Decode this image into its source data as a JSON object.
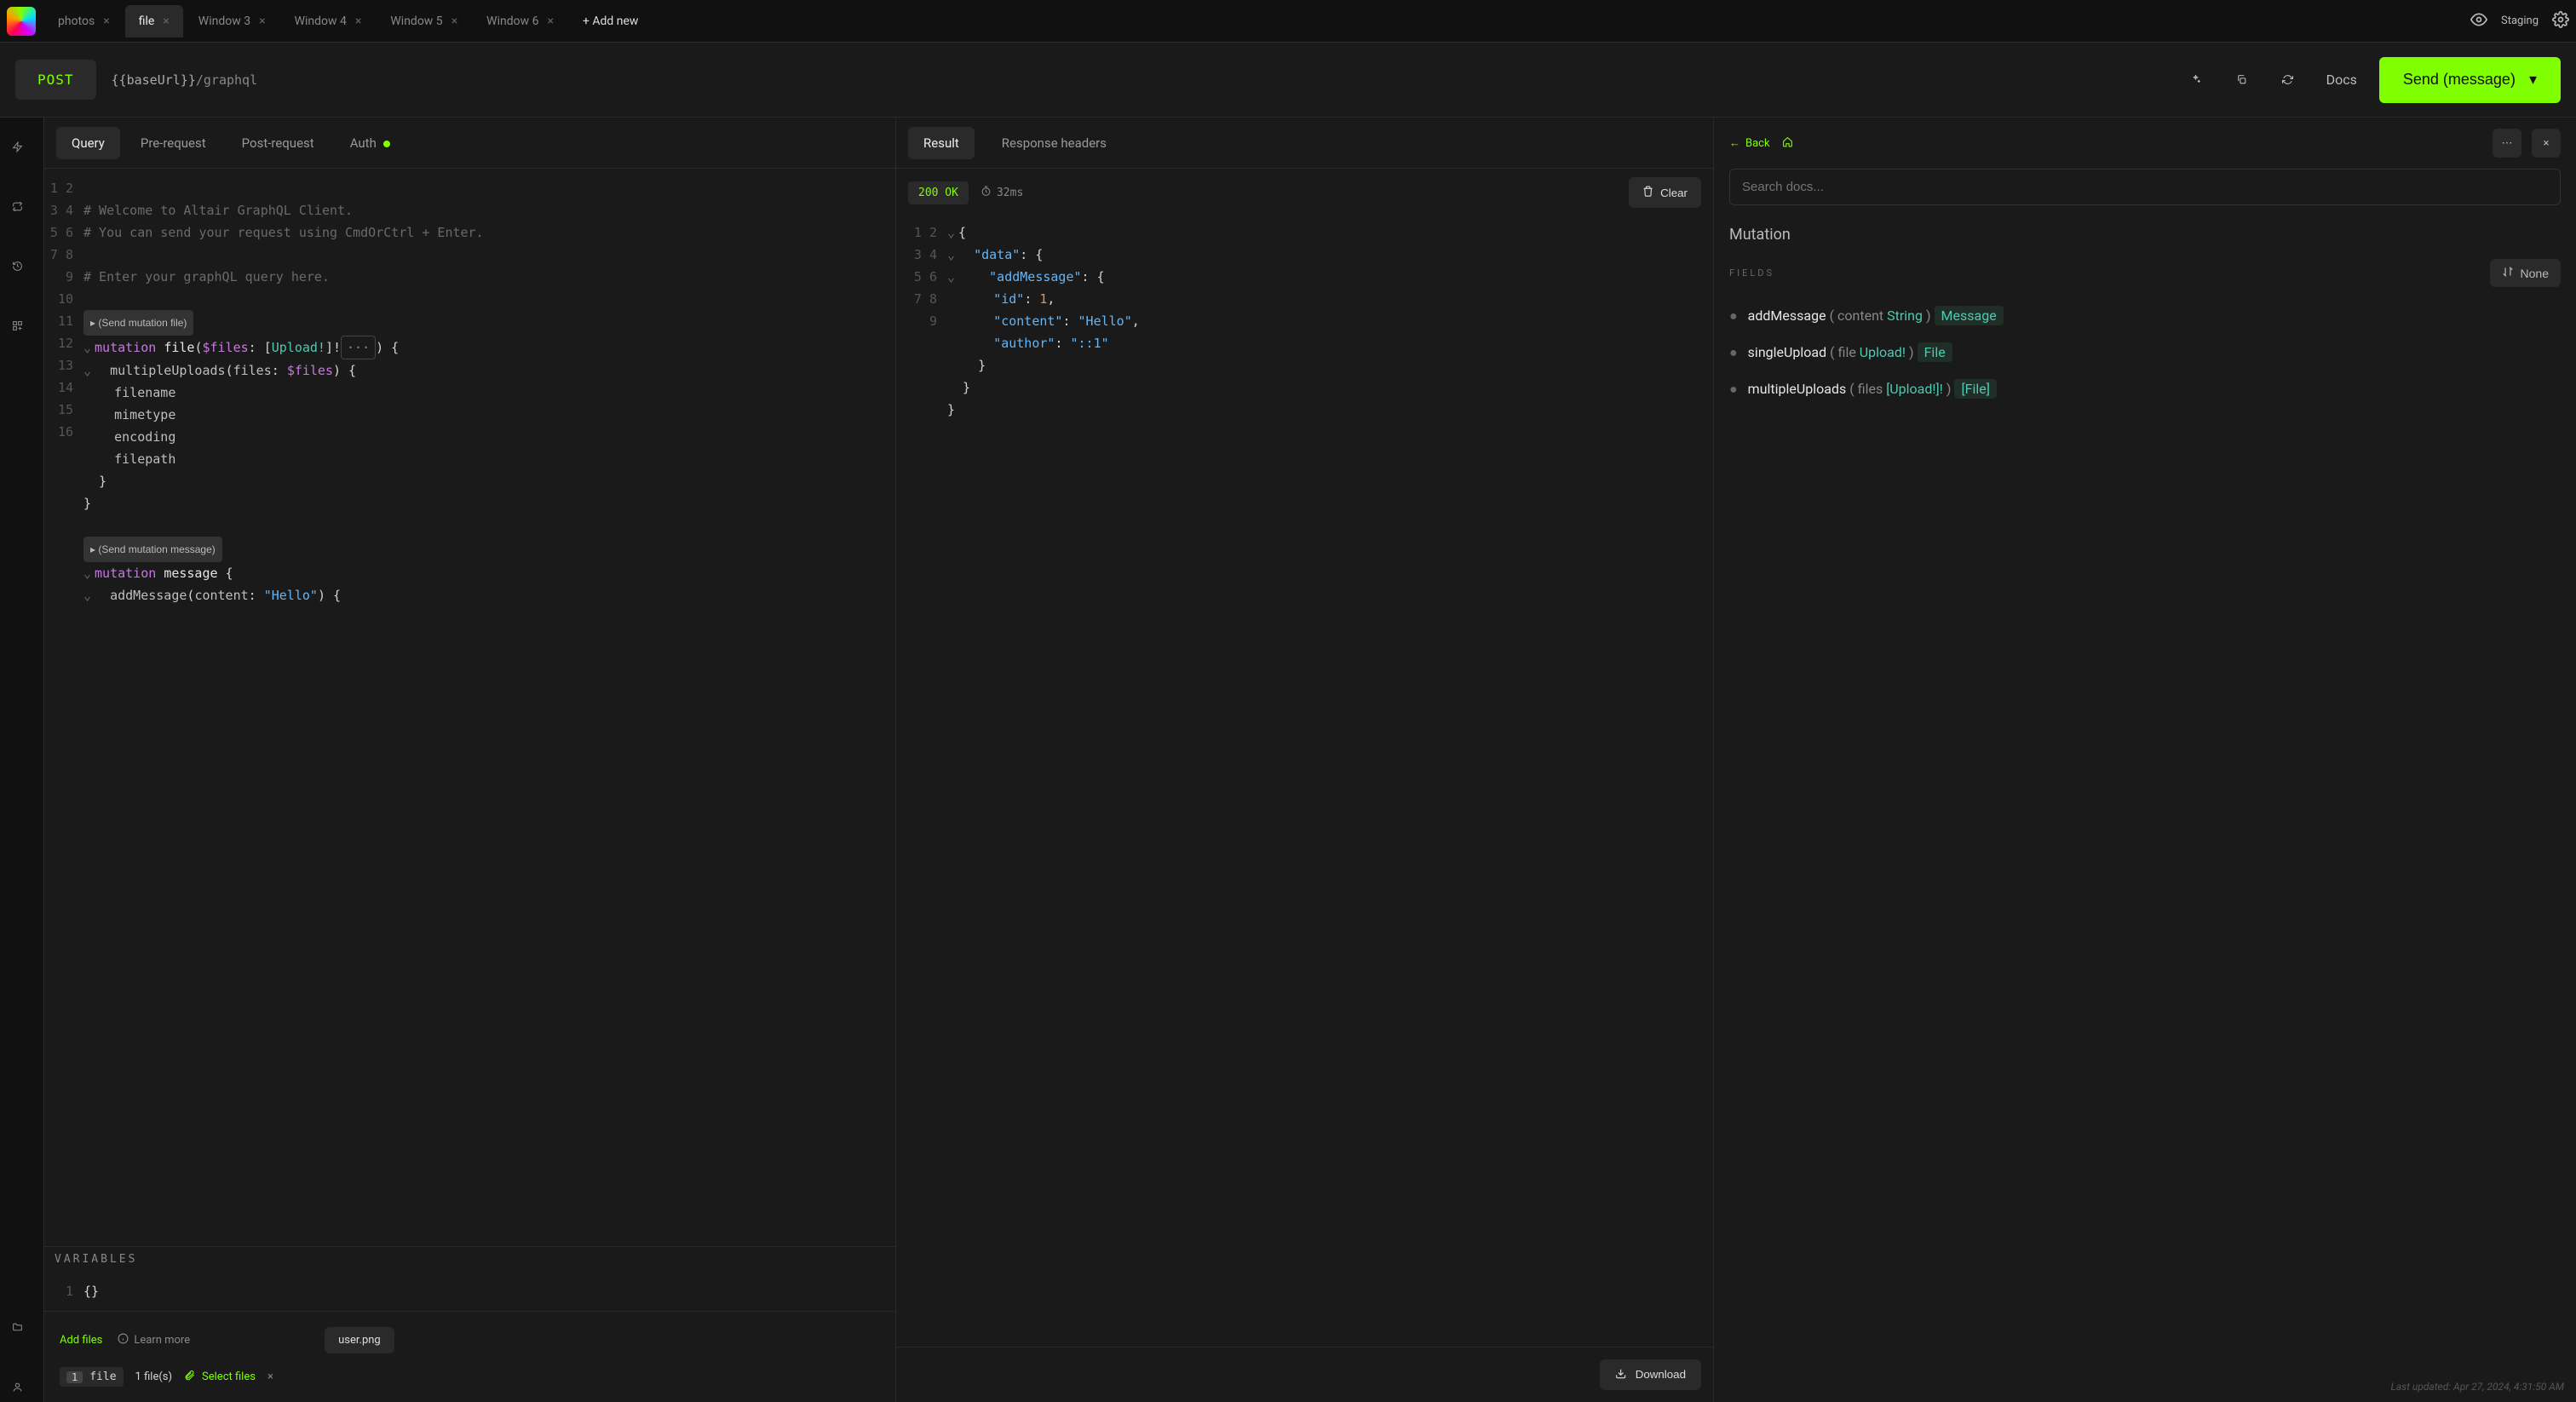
{
  "tabs": [
    {
      "label": "photos",
      "closable": true
    },
    {
      "label": "file",
      "closable": true,
      "active": true
    },
    {
      "label": "Window 3",
      "closable": true
    },
    {
      "label": "Window 4",
      "closable": true
    },
    {
      "label": "Window 5",
      "closable": true
    },
    {
      "label": "Window 6",
      "closable": true
    }
  ],
  "add_tab_label": "+ Add new",
  "topbar": {
    "staging_label": "Staging"
  },
  "actionbar": {
    "method": "POST",
    "url_var": "{{baseUrl}}",
    "url_path": "/graphql",
    "docs_label": "Docs",
    "send_label": "Send (message)"
  },
  "subtabs": {
    "query": "Query",
    "pre": "Pre-request",
    "post": "Post-request",
    "auth": "Auth"
  },
  "editor": {
    "lines": {
      "l1": "# Welcome to Altair GraphQL Client.",
      "l2a": "# You can send your request using CmdOrCtrl + Enter.",
      "l4": "# Enter your graphQL query here."
    },
    "pill_file": "▸ (Send mutation file)",
    "pill_msg": "▸ (Send mutation message)",
    "m1_kw": "mutation",
    "m1_name": "file",
    "m1_arg": "$files",
    "m1_type": "Upload!",
    "mu_field": "multipleUploads",
    "mu_arg": "files",
    "mu_val": "$files",
    "f_filename": "filename",
    "f_mimetype": "mimetype",
    "f_encoding": "encoding",
    "f_filepath": "filepath",
    "m2_name": "message",
    "am_field": "addMessage",
    "am_arg": "content",
    "am_val": "\"Hello\"",
    "variables_label": "VARIABLES",
    "variables_body": "{}"
  },
  "footer": {
    "add_files": "Add files",
    "learn_more": "Learn more",
    "attachment": "user.png",
    "file_chip": "file",
    "file_count": "1 file(s)",
    "select_files": "Select files"
  },
  "result": {
    "tab_result": "Result",
    "tab_headers": "Response headers",
    "status_code": "200 OK",
    "timing": "32ms",
    "clear": "Clear",
    "download": "Download",
    "json": {
      "data_k": "\"data\"",
      "addMessage_k": "\"addMessage\"",
      "id_k": "\"id\"",
      "id_v": "1",
      "content_k": "\"content\"",
      "content_v": "\"Hello\"",
      "author_k": "\"author\"",
      "author_v": "\"::1\""
    }
  },
  "docs": {
    "back": "Back",
    "search_placeholder": "Search docs...",
    "title": "Mutation",
    "fields_label": "FIELDS",
    "sort": "None",
    "f1": {
      "name": "addMessage",
      "arg": "content",
      "argtype": "String",
      "ret": "Message"
    },
    "f2": {
      "name": "singleUpload",
      "arg": "file",
      "argtype": "Upload!",
      "ret": "File"
    },
    "f3": {
      "name": "multipleUploads",
      "arg": "files",
      "argtype": "[Upload!]!",
      "ret": "[File]"
    }
  },
  "status": "Last updated: Apr 27, 2024, 4:31:50 AM"
}
